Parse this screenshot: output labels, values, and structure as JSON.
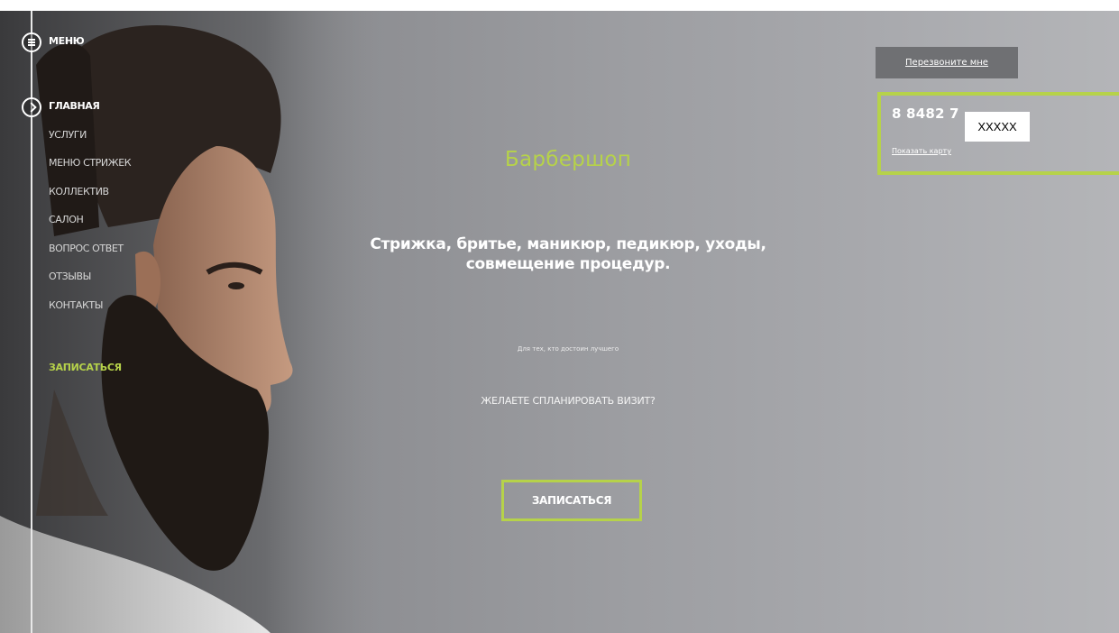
{
  "menu": {
    "title": "МЕНЮ",
    "items": [
      {
        "label": "ГЛАВНАЯ"
      },
      {
        "label": "УСЛУГИ"
      },
      {
        "label": "МЕНЮ СТРИЖЕК"
      },
      {
        "label": "КОЛЛЕКТИВ"
      },
      {
        "label": "САЛОН"
      },
      {
        "label": "ВОПРОС ОТВЕТ"
      },
      {
        "label": "ОТЗЫВЫ"
      },
      {
        "label": "КОНТАКТЫ"
      }
    ],
    "cta": "ЗАПИСАТЬСЯ"
  },
  "hero": {
    "title": "Барбершоп",
    "services": "Стрижка, бритье, маникюр, педикюр, уходы, совмещение процедур.",
    "tagline": "Для тех, кто достоин лучшего",
    "question": "ЖЕЛАЕТЕ СПЛАНИРОВАТЬ ВИЗИТ?",
    "button": "ЗАПИСАТЬСЯ"
  },
  "contact": {
    "callback": "Перезвоните мне",
    "phone": "8 8482 7",
    "phone_redacted": "XXXXX",
    "map_link": "Показать карту"
  },
  "colors": {
    "accent": "#b6d24a",
    "background": "#9c9da1",
    "callback_bg": "#6f7073"
  },
  "icons": {
    "menu": "hamburger-circle-icon",
    "home": "chevron-right-circle-icon"
  }
}
